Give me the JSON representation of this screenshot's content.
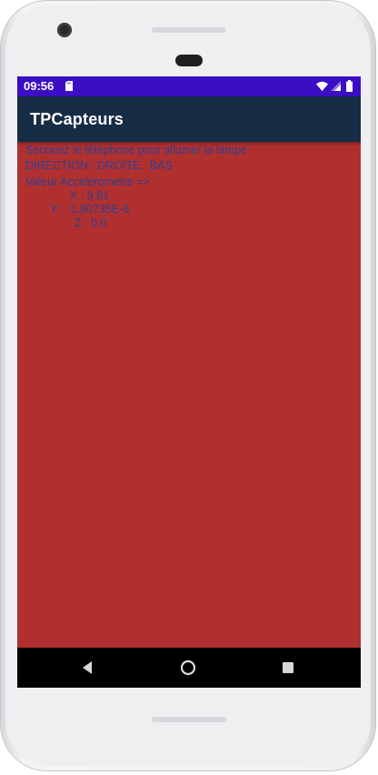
{
  "status_bar": {
    "time": "09:56",
    "icons": [
      "sd-card-icon",
      "wifi-icon",
      "signal-icon",
      "battery-icon"
    ]
  },
  "app_bar": {
    "title": "TPCapteurs"
  },
  "main": {
    "background_color": "#b03030",
    "text_color": "#2f3f8f",
    "instruction": "Secouez le téléphone pour allumer la lampe",
    "direction": "DIRECTION : DROITE,  BAS",
    "accelerometer_label": "Valeur Accelerometre =>",
    "x_value": "X : 9.81",
    "y_value": "Y : -1.90735E-6",
    "z_value": "Z : 0.0"
  },
  "nav_bar": {
    "buttons": [
      "back-icon",
      "home-icon",
      "recents-icon"
    ]
  },
  "colors": {
    "status_bar": "#3b0ec4",
    "app_bar": "#172c45",
    "nav_bar": "#000000"
  }
}
